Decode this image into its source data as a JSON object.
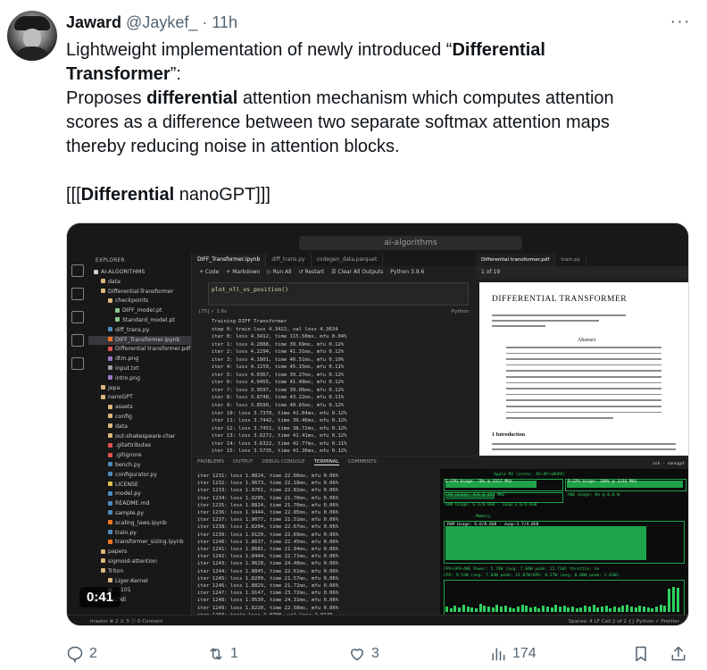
{
  "author": {
    "name": "Jaward",
    "handle": "@Jaykef_",
    "separator": "·",
    "time": "11h"
  },
  "more_label": "···",
  "tweet": {
    "l1_pre": "Lightweight implementation of newly introduced “",
    "l1_bold": "Differential",
    "l2_bold": "Transformer",
    "l2_post": "”:",
    "l3_pre": "Proposes ",
    "l3_bold": "differential",
    "l3_post": " attention mechanism which computes attention",
    "l4": "scores as a difference between two separate softmax attention maps",
    "l5": "thereby reducing noise in attention blocks.",
    "l6_pre": "[[[",
    "l6_bold": "Differential",
    "l6_post": " nanoGPT]]]"
  },
  "video": {
    "time": "0:41",
    "search": "ai-algorithms",
    "explorer_header": "EXPLORER",
    "tree": [
      {
        "label": "AI-ALGORITHMS",
        "indent": 0,
        "color": "#cccccc"
      },
      {
        "label": "data",
        "indent": 8,
        "color": "#dcb67a"
      },
      {
        "label": "Differential-Transformer",
        "indent": 8,
        "color": "#dcb67a"
      },
      {
        "label": "checkpoints",
        "indent": 16,
        "color": "#dcb67a"
      },
      {
        "label": "DIFF_model.pt",
        "indent": 24,
        "color": "#8dc891"
      },
      {
        "label": "Standard_model.pt",
        "indent": 24,
        "color": "#8dc891"
      },
      {
        "label": "diff_trans.py",
        "indent": 16,
        "color": "#4b8bbe"
      },
      {
        "label": "DIFF_Transformer.ipynb",
        "indent": 16,
        "color": "#f37626",
        "sel": true
      },
      {
        "label": "Differential transformer.pdf",
        "indent": 16,
        "color": "#e05252"
      },
      {
        "label": "dtm.png",
        "indent": 16,
        "color": "#a074c4"
      },
      {
        "label": "input.txt",
        "indent": 16,
        "color": "#9d9d9d"
      },
      {
        "label": "intro.png",
        "indent": 16,
        "color": "#a074c4"
      },
      {
        "label": "jepa",
        "indent": 8,
        "color": "#dcb67a"
      },
      {
        "label": "nanoGPT",
        "indent": 8,
        "color": "#dcb67a"
      },
      {
        "label": "assets",
        "indent": 16,
        "color": "#dcb67a"
      },
      {
        "label": "config",
        "indent": 16,
        "color": "#dcb67a"
      },
      {
        "label": "data",
        "indent": 16,
        "color": "#dcb67a"
      },
      {
        "label": "out-shakespeare-char",
        "indent": 16,
        "color": "#dcb67a"
      },
      {
        "label": ".gitattributes",
        "indent": 16,
        "color": "#e05252"
      },
      {
        "label": ".gitignore",
        "indent": 16,
        "color": "#e05252"
      },
      {
        "label": "bench.py",
        "indent": 16,
        "color": "#4b8bbe"
      },
      {
        "label": "configurator.py",
        "indent": 16,
        "color": "#4b8bbe"
      },
      {
        "label": "LICENSE",
        "indent": 16,
        "color": "#e0c050"
      },
      {
        "label": "model.py",
        "indent": 16,
        "color": "#4b8bbe"
      },
      {
        "label": "README.md",
        "indent": 16,
        "color": "#4b8bbe"
      },
      {
        "label": "sample.py",
        "indent": 16,
        "color": "#4b8bbe"
      },
      {
        "label": "scaling_laws.ipynb",
        "indent": 16,
        "color": "#f37626"
      },
      {
        "label": "train.py",
        "indent": 16,
        "color": "#4b8bbe"
      },
      {
        "label": "transformer_sizing.ipynb",
        "indent": 16,
        "color": "#f37626"
      },
      {
        "label": "papers",
        "indent": 8,
        "color": "#dcb67a"
      },
      {
        "label": "sigmoid-attention",
        "indent": 8,
        "color": "#dcb67a"
      },
      {
        "label": "Triton",
        "indent": 8,
        "color": "#dcb67a"
      },
      {
        "label": "Liger-Kernel",
        "indent": 16,
        "color": "#dcb67a"
      },
      {
        "label": "...101",
        "indent": 16,
        "color": "#9d9d9d"
      },
      {
        "label": "TIMELINE",
        "indent": 0,
        "color": "#9d9d9d"
      }
    ],
    "editor_tabs": [
      "DIFF_Transformer.ipynb",
      "diff_trans.py",
      "codegen_data.parquet"
    ],
    "nb_toolbar": [
      "+ Code",
      "+ Markdown",
      "▷ Run All",
      "↺ Restart",
      "☰ Clear All Outputs",
      "Python 3.9.6"
    ],
    "code_line": "plot_nll_vs_position()",
    "cell_status": "[75]   ✓ 1.6s",
    "cell_lang": "Python",
    "output_lines": [
      "Training DIFF Transformer",
      "step 0: train loss 4.3422, val loss 4.3634",
      "iter 0: loss 4.3412, time 115.50ms, mfu 0.04%",
      "iter 1: loss 4.2888, time 39.69ms, mfu 0.12%",
      "iter 2: loss 4.2294, time 41.31ms, mfu 0.12%",
      "iter 3: loss 4.1801, time 46.51ms, mfu 0.10%",
      "iter 4: loss 4.1150, time 45.15ms, mfu 0.11%",
      "iter 5: loss 4.0367, time 39.27ms, mfu 0.12%",
      "iter 6: loss 4.0455, time 41.49ms, mfu 0.12%",
      "iter 7: loss 3.9597, time 39.06ms, mfu 0.12%",
      "iter 8: loss 3.8748, time 43.22ms, mfu 0.11%",
      "iter 9: loss 3.8590, time 40.65ms, mfu 0.12%",
      "iter 10: loss 3.7370, time 41.04ms, mfu 0.12%",
      "iter 11: loss 3.7442, time 39.46ms, mfu 0.12%",
      "iter 12: loss 3.7451, time 38.72ms, mfu 0.12%",
      "iter 13: loss 3.6272, time 41.41ms, mfu 0.12%",
      "iter 14: loss 3.6322, time 42.77ms, mfu 0.11%",
      "iter 15: loss 3.5735, time 41.36ms, mfu 0.12%"
    ],
    "pdf_tabs": [
      "Differential transformer.pdf",
      "train.py"
    ],
    "pdf_page_label": "1 of 19",
    "pdf_title": "DIFFERENTIAL TRANSFORMER",
    "pdf_abstract": "Abstract",
    "pdf_intro": "1   Introduction",
    "panel_tabs": [
      "PROBLEMS",
      "OUTPUT",
      "DEBUG CONSOLE",
      "TERMINAL",
      "COMMENTS"
    ],
    "terminal_lines": [
      "iter 1231: loss 1.8814, time 22.66ms, mfu 0.06%",
      "iter 1232: loss 1.9673, time 22.18ms, mfu 0.06%",
      "iter 1233: loss 1.9761, time 22.81ms, mfu 0.06%",
      "iter 1234: loss 1.9295, time 21.70ms, mfu 0.06%",
      "iter 1235: loss 1.8824, time 21.70ms, mfu 0.06%",
      "iter 1236: loss 1.9444, time 22.85ms, mfu 0.06%",
      "iter 1237: loss 1.9077, time 21.51ms, mfu 0.06%",
      "iter 1238: loss 1.8204, time 22.67ms, mfu 0.06%",
      "iter 1239: loss 1.9129, time 22.69ms, mfu 0.06%",
      "iter 1240: loss 1.8637, time 22.45ms, mfu 0.06%",
      "iter 1241: loss 1.8681, time 21.94ms, mfu 0.06%",
      "iter 1242: loss 1.8444, time 22.71ms, mfu 0.06%",
      "iter 1243: loss 1.9628, time 24.48ms, mfu 0.06%",
      "iter 1244: loss 1.8845, time 22.61ms, mfu 0.06%",
      "iter 1245: loss 1.8209, time 21.57ms, mfu 0.06%",
      "iter 1246: loss 1.8829, time 21.72ms, mfu 0.06%",
      "iter 1247: loss 1.9147, time 23.72ms, mfu 0.06%",
      "iter 1248: loss 1.9530, time 24.31ms, mfu 0.06%",
      "iter 1249: loss 1.8220, time 22.58ms, mfu 0.06%",
      "step 1250: train loss 1.8708, val loss 2.0179",
      "saving checkpoint to out-shakespeare-char",
      "iter 1250: loss 1.8481, time 319.96ms, mfu 0.05%",
      "iter 1251: loss 1.9167, time 22.25ms, mfu 0.05%"
    ],
    "asitop": {
      "title": "Apple M2 (cores: 4E+4P+10GPU)",
      "ecpu": "E-CPU Usage: 78% @ 1557 MHz",
      "pcpu": "P-CPU Usage: 100% @ 3316 MHz",
      "cpu": "CPU Usage: 42% @ 444 MHz",
      "ane": "ANE Usage: 0% @ 0.0 W",
      "ram": "RAM Usage: 6.1/8.0GB - swap:3.6/4.0GB",
      "memory": "Memory",
      "ram2": "RAM Usage: 6.6/8.0GB - swap:3.7/4.0GB",
      "power": "CPU+GPU+ANE Power: 5.74W (avg: 7.84W peak: 22.71W) throttle: no",
      "cpu_power": "CPU: 9.53W (avg: 7.84W peak: 21.07W)GPU: 0.27W (avg: 0.00W peak: 2.63W)"
    },
    "terminal_title": "zsh - nanogpt",
    "status_left": "master  ⊗ 2 ⚠ 3   ⓘ 0   Connect",
    "status_right": "Spaces: 4   LF   Cell 2 of 2   {} Python   ✓ Prettier"
  },
  "actions": {
    "replies": "2",
    "reposts": "1",
    "likes": "3",
    "views": "174"
  }
}
